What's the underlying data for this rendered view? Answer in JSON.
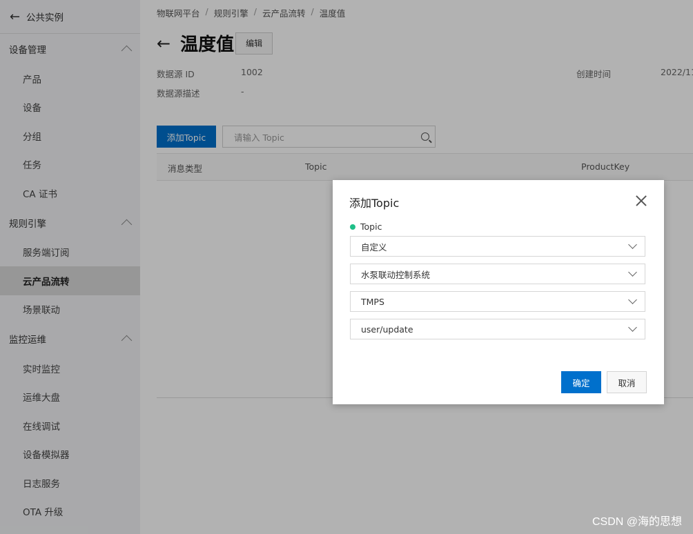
{
  "sidebar": {
    "back_label": "公共实例",
    "groups": [
      {
        "label": "设备管理",
        "items": [
          "产品",
          "设备",
          "分组",
          "任务",
          "CA 证书"
        ]
      },
      {
        "label": "规则引擎",
        "items": [
          "服务端订阅",
          "云产品流转",
          "场景联动"
        ]
      },
      {
        "label": "监控运维",
        "items": [
          "实时监控",
          "运维大盘",
          "在线调试",
          "设备模拟器",
          "日志服务",
          "OTA 升级"
        ]
      }
    ],
    "active_item": "云产品流转"
  },
  "breadcrumb": [
    "物联网平台",
    "规则引擎",
    "云产品流转",
    "温度值"
  ],
  "page": {
    "title": "温度值",
    "edit_label": "编辑",
    "datasource_id_label": "数据源 ID",
    "datasource_id_value": "1002",
    "datasource_desc_label": "数据源描述",
    "datasource_desc_value": "-",
    "created_label": "创建时间",
    "created_value": "2022/11/"
  },
  "toolbar": {
    "add_label": "添加Topic",
    "search_placeholder": "请输入 Topic"
  },
  "table": {
    "columns": [
      "消息类型",
      "Topic",
      "ProductKey"
    ]
  },
  "dialog": {
    "title": "添加Topic",
    "field_label": "Topic",
    "selects": [
      "自定义",
      "水泵联动控制系统",
      "TMPS",
      "user/update"
    ],
    "ok_label": "确定",
    "cancel_label": "取消"
  },
  "watermark": "CSDN @海的思想",
  "colors": {
    "primary": "#0070cc",
    "required_dot": "#1fbf88",
    "sidebar_bg": "#f2f3f5"
  }
}
